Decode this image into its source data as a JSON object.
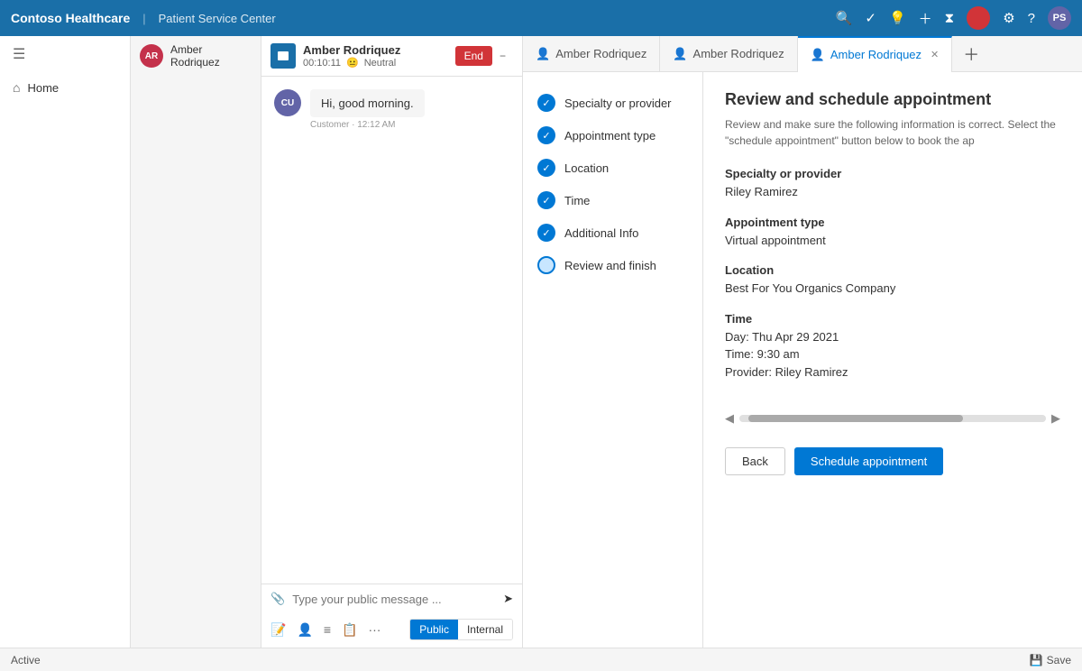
{
  "app": {
    "brand": "Contoso Healthcare",
    "divider": "|",
    "subtitle": "Patient Service Center"
  },
  "topNav": {
    "icons": [
      "search",
      "checkmark",
      "lightbulb",
      "plus",
      "filter",
      "settings",
      "help"
    ],
    "avatarLabel": "PS",
    "redDot": true
  },
  "sidebar": {
    "menu_icon": "☰",
    "items": [
      {
        "label": "Home",
        "icon": "⌂"
      }
    ]
  },
  "contacts": {
    "items": [
      {
        "initials": "AR",
        "name": "Amber Rodriquez"
      }
    ]
  },
  "callPanel": {
    "agentName": "Amber Rodriquez",
    "timer": "00:10:11",
    "sentiment": "Neutral",
    "endLabel": "End"
  },
  "chatMessages": [
    {
      "avatarInitials": "CU",
      "text": "Hi, good morning.",
      "time": "Customer · 12:12 AM"
    }
  ],
  "chatInput": {
    "placeholder": "Type your public message ..."
  },
  "chatToolbar": {
    "publicLabel": "Public",
    "internalLabel": "Internal"
  },
  "tabs": [
    {
      "label": "Amber Rodriquez",
      "active": false,
      "closeable": false
    },
    {
      "label": "Amber Rodriquez",
      "active": false,
      "closeable": false
    },
    {
      "label": "Amber Rodriquez",
      "active": true,
      "closeable": true
    }
  ],
  "steps": [
    {
      "label": "Specialty or provider",
      "state": "done"
    },
    {
      "label": "Appointment type",
      "state": "done"
    },
    {
      "label": "Location",
      "state": "done"
    },
    {
      "label": "Time",
      "state": "done"
    },
    {
      "label": "Additional Info",
      "state": "done"
    },
    {
      "label": "Review and finish",
      "state": "current"
    }
  ],
  "review": {
    "title": "Review and schedule appointment",
    "subtitle": "Review and make sure the following information is correct. Select the \"schedule appointment\" button below to book the ap",
    "fields": [
      {
        "label": "Specialty or provider",
        "value": "Riley Ramirez"
      },
      {
        "label": "Appointment type",
        "value": "Virtual appointment"
      },
      {
        "label": "Location",
        "value": "Best For You Organics Company"
      },
      {
        "label": "Time",
        "value": "Day: Thu Apr 29 2021\nTime: 9:30 am\nProvider: Riley Ramirez"
      }
    ],
    "backLabel": "Back",
    "scheduleLabel": "Schedule appointment"
  },
  "statusBar": {
    "activeLabel": "Active",
    "saveLabel": "Save"
  }
}
